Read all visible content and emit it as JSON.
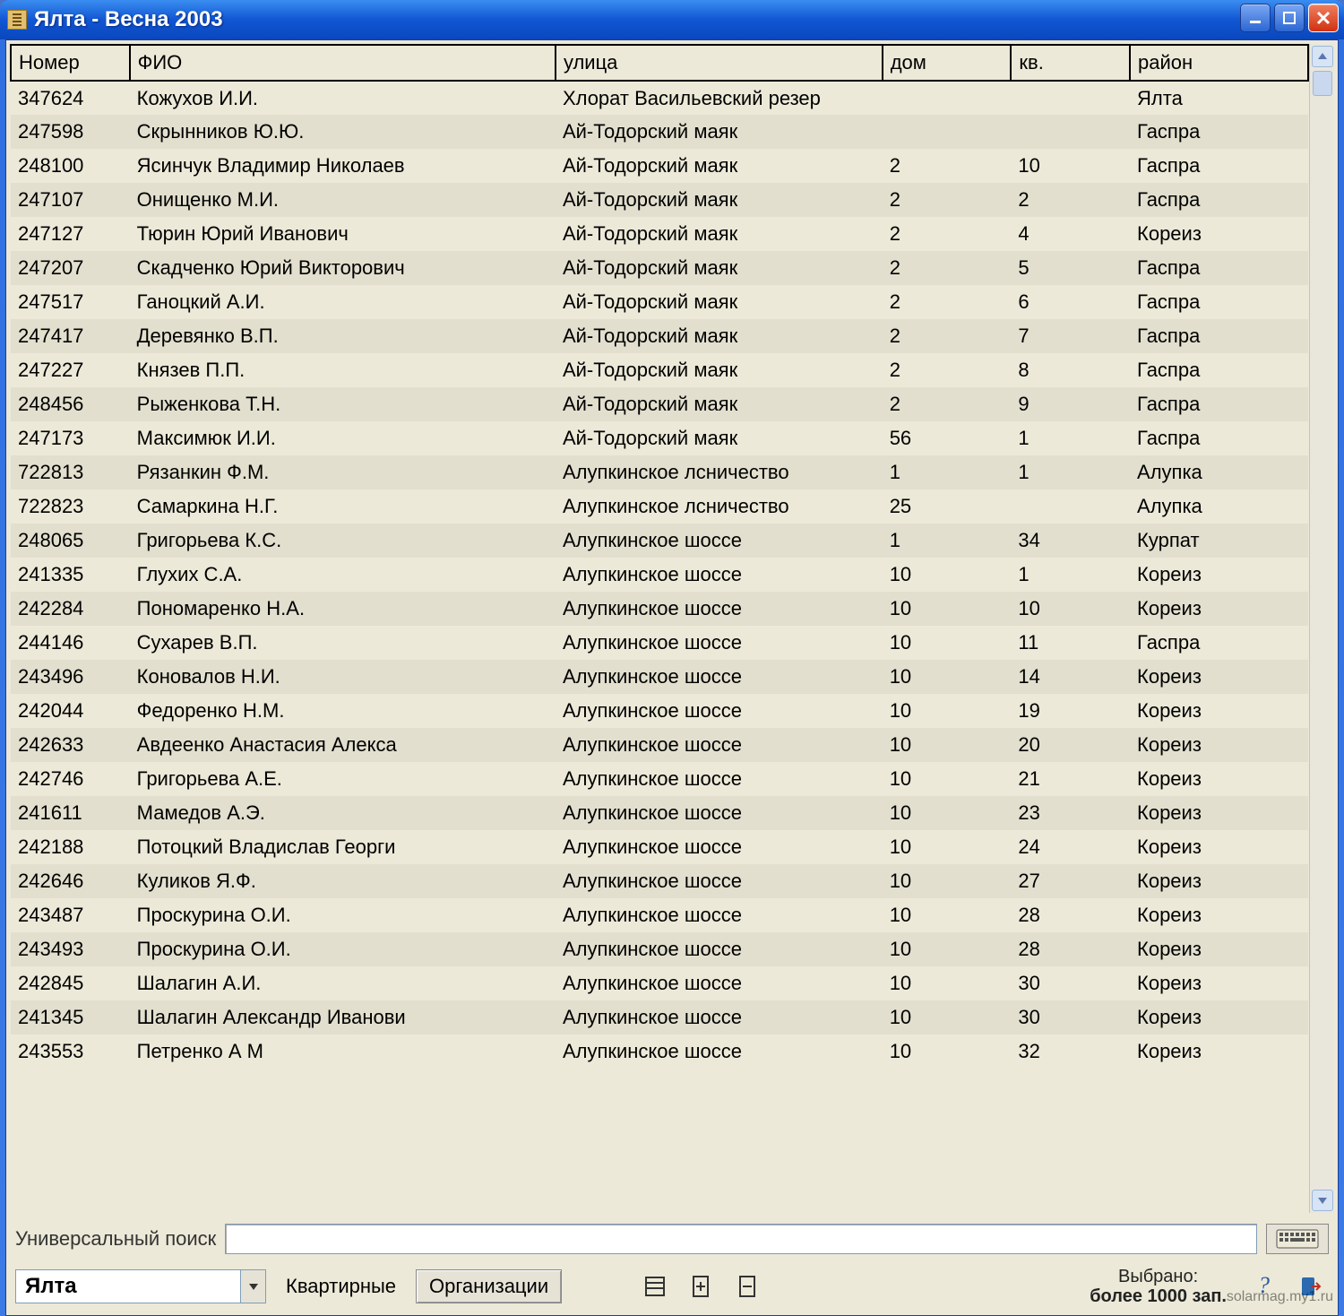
{
  "window": {
    "title": "Ялта  - Весна 2003"
  },
  "columns": [
    "Номер",
    "ФИО",
    "улица",
    "дом",
    "кв.",
    "район"
  ],
  "rows": [
    {
      "num": "347624",
      "fio": "Кожухов И.И.",
      "street": " Хлорат Васильевский резер",
      "house": "",
      "apt": "",
      "district": "Ялта"
    },
    {
      "num": "247598",
      "fio": "Скрынников Ю.Ю.",
      "street": "Ай-Тодорский маяк",
      "house": "",
      "apt": "",
      "district": "Гаспра"
    },
    {
      "num": "248100",
      "fio": "Ясинчук Владимир Николаев",
      "street": "Ай-Тодорский маяк",
      "house": "2",
      "apt": "10",
      "district": "Гаспра"
    },
    {
      "num": "247107",
      "fio": "Онищенко М.И.",
      "street": "Ай-Тодорский маяк",
      "house": "2",
      "apt": "2",
      "district": "Гаспра"
    },
    {
      "num": "247127",
      "fio": "Тюрин Юрий Иванович",
      "street": "Ай-Тодорский маяк",
      "house": "2",
      "apt": "4",
      "district": "Кореиз"
    },
    {
      "num": "247207",
      "fio": "Скадченко Юрий Викторович",
      "street": "Ай-Тодорский маяк",
      "house": "2",
      "apt": "5",
      "district": "Гаспра"
    },
    {
      "num": "247517",
      "fio": "Ганоцкий А.И.",
      "street": "Ай-Тодорский маяк",
      "house": "2",
      "apt": "6",
      "district": "Гаспра"
    },
    {
      "num": "247417",
      "fio": "Деревянко В.П.",
      "street": "Ай-Тодорский маяк",
      "house": "2",
      "apt": "7",
      "district": "Гаспра"
    },
    {
      "num": "247227",
      "fio": "Князев П.П.",
      "street": "Ай-Тодорский маяк",
      "house": "2",
      "apt": "8",
      "district": "Гаспра"
    },
    {
      "num": "248456",
      "fio": "Рыженкова Т.Н.",
      "street": "Ай-Тодорский маяк",
      "house": "2",
      "apt": "9",
      "district": "Гаспра"
    },
    {
      "num": "247173",
      "fio": "Максимюк И.И.",
      "street": "Ай-Тодорский маяк",
      "house": "56",
      "apt": "1",
      "district": "Гаспра"
    },
    {
      "num": "722813",
      "fio": "Рязанкин Ф.М.",
      "street": "Алупкинское лсничество",
      "house": "1",
      "apt": "1",
      "district": "Алупка"
    },
    {
      "num": "722823",
      "fio": "Самаркина Н.Г.",
      "street": "Алупкинское лсничество",
      "house": "25",
      "apt": "",
      "district": "Алупка"
    },
    {
      "num": "248065",
      "fio": "Григорьева К.С.",
      "street": "Алупкинское шоссе",
      "house": "1",
      "apt": "34",
      "district": "Курпат"
    },
    {
      "num": "241335",
      "fio": "Глухих С.А.",
      "street": "Алупкинское шоссе",
      "house": "10",
      "apt": "1",
      "district": "Кореиз"
    },
    {
      "num": "242284",
      "fio": "Пономаренко Н.А.",
      "street": "Алупкинское шоссе",
      "house": "10",
      "apt": "10",
      "district": "Кореиз"
    },
    {
      "num": "244146",
      "fio": "Сухарев В.П.",
      "street": "Алупкинское шоссе",
      "house": "10",
      "apt": "11",
      "district": "Гаспра"
    },
    {
      "num": "243496",
      "fio": "Коновалов Н.И.",
      "street": "Алупкинское шоссе",
      "house": "10",
      "apt": "14",
      "district": "Кореиз"
    },
    {
      "num": "242044",
      "fio": "Федоренко Н.М.",
      "street": "Алупкинское шоссе",
      "house": "10",
      "apt": "19",
      "district": "Кореиз"
    },
    {
      "num": "242633",
      "fio": "Авдеенко Анастасия Алекса",
      "street": "Алупкинское шоссе",
      "house": "10",
      "apt": "20",
      "district": "Кореиз"
    },
    {
      "num": "242746",
      "fio": "Григорьева А.Е.",
      "street": "Алупкинское шоссе",
      "house": "10",
      "apt": "21",
      "district": "Кореиз"
    },
    {
      "num": "241611",
      "fio": "Мамедов А.Э.",
      "street": "Алупкинское шоссе",
      "house": "10",
      "apt": "23",
      "district": "Кореиз"
    },
    {
      "num": "242188",
      "fio": "Потоцкий Владислав Георги",
      "street": "Алупкинское шоссе",
      "house": "10",
      "apt": "24",
      "district": "Кореиз"
    },
    {
      "num": "242646",
      "fio": "Куликов Я.Ф.",
      "street": "Алупкинское шоссе",
      "house": "10",
      "apt": "27",
      "district": "Кореиз"
    },
    {
      "num": "243487",
      "fio": "Проскурина О.И.",
      "street": "Алупкинское шоссе",
      "house": "10",
      "apt": "28",
      "district": "Кореиз"
    },
    {
      "num": "243493",
      "fio": "Проскурина О.И.",
      "street": "Алупкинское шоссе",
      "house": "10",
      "apt": "28",
      "district": "Кореиз"
    },
    {
      "num": "242845",
      "fio": "Шалагин А.И.",
      "street": "Алупкинское шоссе",
      "house": "10",
      "apt": "30",
      "district": "Кореиз"
    },
    {
      "num": "241345",
      "fio": "Шалагин Александр Иванови",
      "street": "Алупкинское шоссе",
      "house": "10",
      "apt": "30",
      "district": "Кореиз"
    },
    {
      "num": "243553",
      "fio": "Петренко А М",
      "street": "Алупкинское шоссе",
      "house": "10",
      "apt": "32",
      "district": "Кореиз"
    }
  ],
  "search": {
    "label": "Универсальный поиск",
    "value": ""
  },
  "bottom": {
    "combo_value": "Ялта",
    "btn_kvartirnye": "Квартирные",
    "btn_organizacii": "Организации",
    "status_line1": "Выбрано:",
    "status_line2": "более 1000 зап."
  },
  "watermark": "solarmag.my1.ru"
}
